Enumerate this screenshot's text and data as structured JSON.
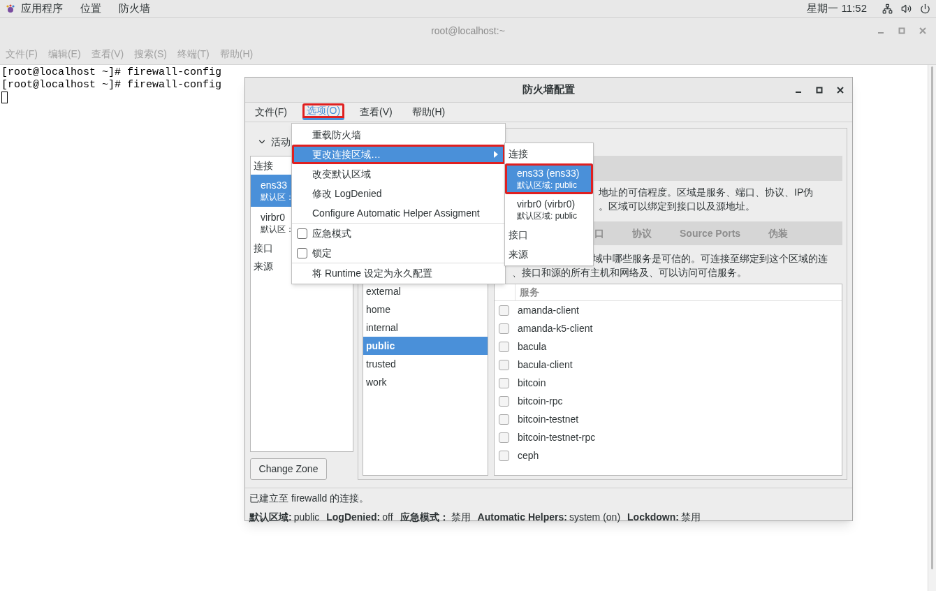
{
  "top_panel": {
    "menus": [
      "应用程序",
      "位置",
      "防火墙"
    ],
    "clock": "星期一 11:52"
  },
  "terminal": {
    "title": "root@localhost:~",
    "menus": [
      "文件(F)",
      "编辑(E)",
      "查看(V)",
      "搜索(S)",
      "终端(T)",
      "帮助(H)"
    ],
    "lines": [
      "[root@localhost ~]# firewall-config",
      "[root@localhost ~]# firewall-config"
    ]
  },
  "firewall": {
    "title": "防火墙配置",
    "menus": [
      {
        "label": "文件(F)",
        "selected": false,
        "annotated": false
      },
      {
        "label": "选项(O)",
        "selected": true,
        "annotated": true
      },
      {
        "label": "查看(V)",
        "selected": false,
        "annotated": false
      },
      {
        "label": "帮助(H)",
        "selected": false,
        "annotated": false
      }
    ],
    "bindings": {
      "label": "活动",
      "expanded": true,
      "items": [
        {
          "kind": "header",
          "label": "连接"
        },
        {
          "kind": "connection",
          "name": "ens33",
          "zone": "默认区：",
          "selected": true
        },
        {
          "kind": "connection",
          "name": "virbr0",
          "zone": "默认区：",
          "selected": false
        },
        {
          "kind": "header",
          "label": "接口"
        },
        {
          "kind": "header",
          "label": "来源"
        }
      ]
    },
    "change_zone_button": "Change Zone",
    "zone_description": [
      "地址的可信程度。区域是服务、端口、协议、IP伪",
      "。区域可以绑定到接口以及源地址。"
    ],
    "zones": [
      {
        "label": "external",
        "selected": false
      },
      {
        "label": "home",
        "selected": false
      },
      {
        "label": "internal",
        "selected": false
      },
      {
        "label": "public",
        "selected": true
      },
      {
        "label": "trusted",
        "selected": false
      },
      {
        "label": "work",
        "selected": false
      }
    ],
    "tabs": [
      {
        "label": "口",
        "selected": false
      },
      {
        "label": "协议",
        "selected": false
      },
      {
        "label": "Source Ports",
        "selected": false
      },
      {
        "label": "伪装",
        "selected": false
      }
    ],
    "services_description": [
      "域中哪些服务是可信的。可连接至绑定到这个区域的连",
      "、接口和源的所有主机和网络及、可以访问可信服务。"
    ],
    "services_header": "服务",
    "services": [
      {
        "name": "amanda-client",
        "checked": false
      },
      {
        "name": "amanda-k5-client",
        "checked": false
      },
      {
        "name": "bacula",
        "checked": false
      },
      {
        "name": "bacula-client",
        "checked": false
      },
      {
        "name": "bitcoin",
        "checked": false
      },
      {
        "name": "bitcoin-rpc",
        "checked": false
      },
      {
        "name": "bitcoin-testnet",
        "checked": false
      },
      {
        "name": "bitcoin-testnet-rpc",
        "checked": false
      },
      {
        "name": "ceph",
        "checked": false
      }
    ],
    "status_message": "已建立至 firewalld 的连接。",
    "status": [
      {
        "label": "默认区域:",
        "value": "public"
      },
      {
        "label": "LogDenied:",
        "value": "off"
      },
      {
        "label": "应急模式：",
        "value": "禁用"
      },
      {
        "label": "Automatic Helpers:",
        "value": "system (on)"
      },
      {
        "label": "Lockdown:",
        "value": "禁用"
      }
    ],
    "options_menu": [
      {
        "kind": "action",
        "label": "重载防火墙",
        "selected": false,
        "annotated": false
      },
      {
        "kind": "submenu",
        "label": "更改连接区域…",
        "selected": true,
        "annotated": true
      },
      {
        "kind": "action",
        "label": "改变默认区域",
        "selected": false,
        "annotated": false
      },
      {
        "kind": "action",
        "label": "修改 LogDenied",
        "selected": false,
        "annotated": false
      },
      {
        "kind": "action",
        "label": "Configure Automatic Helper Assigment",
        "selected": false,
        "annotated": false
      },
      {
        "kind": "separator"
      },
      {
        "kind": "check",
        "label": "应急模式",
        "checked": false
      },
      {
        "kind": "check",
        "label": "锁定",
        "checked": false
      },
      {
        "kind": "separator"
      },
      {
        "kind": "action",
        "label": "将 Runtime 设定为永久配置",
        "selected": false,
        "annotated": false
      }
    ],
    "submenu": [
      {
        "kind": "header",
        "label": "连接"
      },
      {
        "kind": "connection",
        "name": "ens33 (ens33)",
        "zone": "默认区域: public",
        "selected": true,
        "annotated": true
      },
      {
        "kind": "connection",
        "name": "virbr0 (virbr0)",
        "zone": "默认区域: public",
        "selected": false,
        "annotated": false
      },
      {
        "kind": "header",
        "label": "接口"
      },
      {
        "kind": "header",
        "label": "来源"
      }
    ]
  }
}
